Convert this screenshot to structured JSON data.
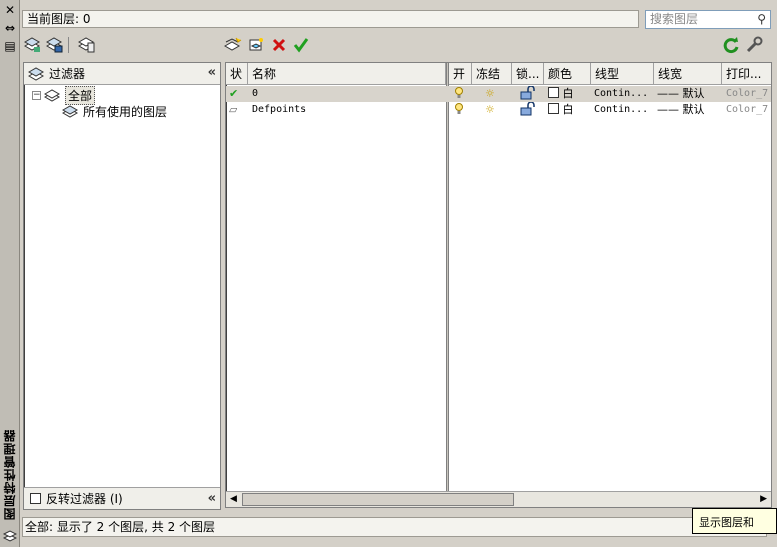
{
  "side": {
    "title": "图层特性管理器",
    "close_glyph": "✕",
    "autohide_glyph": "⇔",
    "props_glyph": "▤"
  },
  "current_layer": {
    "label": "当前图层: 0"
  },
  "search": {
    "placeholder": "搜索图层"
  },
  "toolbar": {
    "left_icons": [
      "new-property-filter-icon",
      "new-group-filter-icon",
      "layer-states-manager-icon"
    ],
    "mid_icons": [
      "new-layer-icon",
      "new-layer-vp-frozen-icon",
      "delete-layer-icon",
      "set-current-icon"
    ],
    "right_icons": [
      "refresh-icon",
      "settings-icon"
    ],
    "accent_colors": {
      "delete": "#d01010",
      "check": "#20a020",
      "refresh": "#209020"
    }
  },
  "filters": {
    "header": "过滤器",
    "collapse_glyph": "«",
    "tree": [
      {
        "label": "全部",
        "expander": "⊟",
        "selected": true
      },
      {
        "label": "所有使用的图层",
        "selected": false
      }
    ],
    "invert_label": "反转过滤器 (I)"
  },
  "layers": {
    "columns": [
      "状",
      "名称",
      "开",
      "冻结",
      "锁...",
      "颜色",
      "线型",
      "线宽",
      "打印..."
    ],
    "rows": [
      {
        "status": "✔",
        "name": "0",
        "on": "💡",
        "freeze": "☼",
        "lock": "🔓",
        "color": "白",
        "linetype": "Contin...",
        "lineweight": "—— 默认",
        "plot": "Color_7",
        "current": true
      },
      {
        "status": "▱",
        "name": "Defpoints",
        "on": "💡",
        "freeze": "☼",
        "lock": "🔓",
        "color": "白",
        "linetype": "Contin...",
        "lineweight": "—— 默认",
        "plot": "Color_7",
        "current": false
      }
    ]
  },
  "status_bar": {
    "text": "全部: 显示了 2 个图层, 共 2 个图层"
  },
  "tooltip": {
    "text": "显示图层和"
  }
}
